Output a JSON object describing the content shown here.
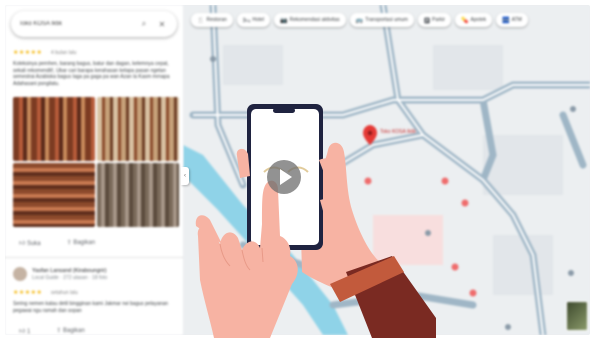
{
  "search": {
    "query": "Toko KOSA Iktik"
  },
  "review_1": {
    "stars": "★★★★★",
    "date": "4 bulan lalu",
    "text": "Koleksinya pernhen, barang bagus, batur dan dagan, kelemnya cepat, sekali rekomendit!, Ubar cari barapa kerahasan kelapa pasan ngetan semestrai Azabiska bagus Iaga pa gaga pa wan Azan la Kasm mrnapa Adahasani psngilatu."
  },
  "review_1_actions": {
    "like": "Suka",
    "share": "Bagikan"
  },
  "review_2": {
    "name": "Yasfan Lansand (Kiraboungrir)",
    "sub": "Local Guide · 272 ulasan · 18 foto",
    "stars": "★★★★★",
    "date": "setahun lalu",
    "text": "Sering nemen kalau detil bingginan kami Jakmar rwi bagus pelayanan pegawai ngu ramah dan sopan"
  },
  "review_2_actions": {
    "like": "1",
    "share": "Bagikan"
  },
  "map_chips": [
    {
      "icon": "🍴",
      "label": "Restoran"
    },
    {
      "icon": "🛏",
      "label": "Hotel"
    },
    {
      "icon": "📷",
      "label": "Rekomendasi aktivitas"
    },
    {
      "icon": "🚌",
      "label": "Transportasi umum"
    },
    {
      "icon": "🅿",
      "label": "Parkir"
    },
    {
      "icon": "💊",
      "label": "Apotek"
    },
    {
      "icon": "🏧",
      "label": "ATM"
    }
  ],
  "destination": {
    "label": "Toko KOSA Iktik"
  },
  "colors": {
    "road": "#9fb6c6",
    "water": "#8fd3e8",
    "pin": "#e53935",
    "skin": "#f7b3a3",
    "sleeve": "#7a2a22",
    "phone": "#1f2340"
  }
}
